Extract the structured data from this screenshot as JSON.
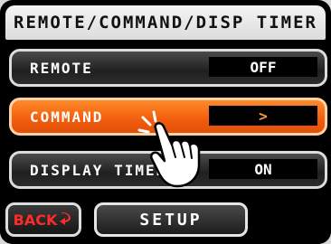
{
  "header": {
    "title": "REMOTE/COMMAND/DISP TIMER"
  },
  "rows": [
    {
      "label": "REMOTE",
      "value": "OFF"
    },
    {
      "label": "COMMAND",
      "value": ">"
    },
    {
      "label": "DISPLAY TIMER",
      "value": "ON"
    }
  ],
  "footer": {
    "back_label": "BACK",
    "setup_label": "SETUP"
  },
  "colors": {
    "active_row": "#f25c0c",
    "back_text": "#ff2a2a"
  },
  "icons": {
    "back": "return-arrow-icon",
    "pointer": "pointing-hand-icon"
  }
}
